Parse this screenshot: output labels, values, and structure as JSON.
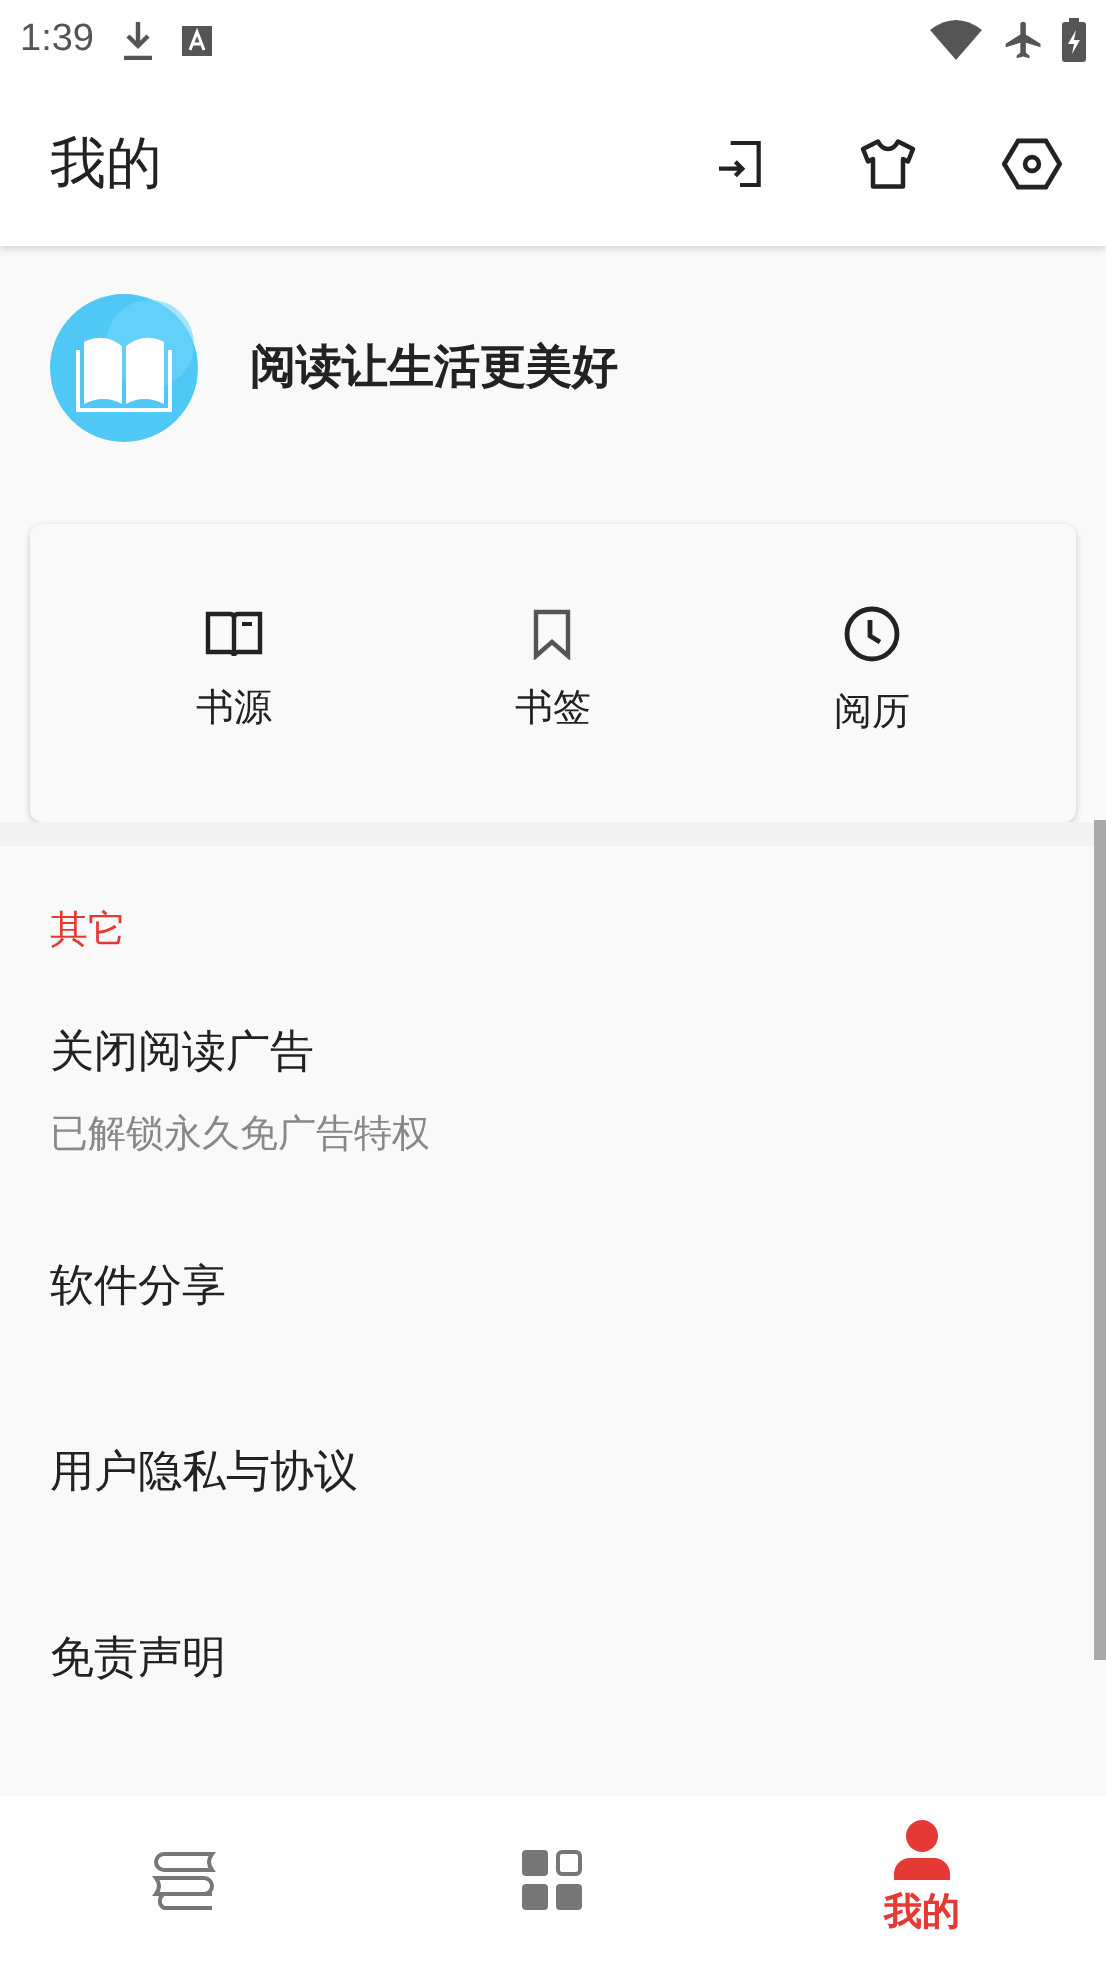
{
  "status_bar": {
    "time": "1:39"
  },
  "app_bar": {
    "title": "我的"
  },
  "profile": {
    "slogan": "阅读让生活更美好"
  },
  "shortcuts": [
    {
      "kind": "book",
      "label": "书源"
    },
    {
      "kind": "bookmark",
      "label": "书签"
    },
    {
      "kind": "clock",
      "label": "阅历"
    }
  ],
  "section": {
    "title": "其它"
  },
  "menu_items": [
    {
      "title": "关闭阅读广告",
      "subtitle": "已解锁永久免广告特权"
    },
    {
      "title": "软件分享"
    },
    {
      "title": "用户隐私与协议"
    },
    {
      "title": "免责声明"
    }
  ],
  "bottom_nav": [
    {
      "kind": "bookshelf",
      "selected": false
    },
    {
      "kind": "grid",
      "selected": false
    },
    {
      "kind": "person",
      "label": "我的",
      "selected": true
    }
  ]
}
